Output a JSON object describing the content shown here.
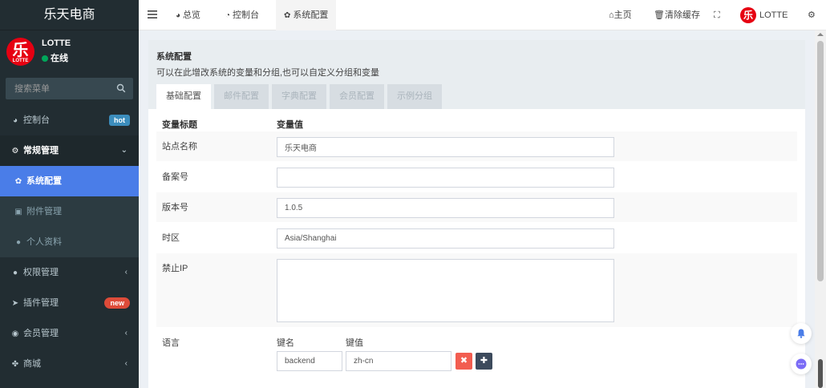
{
  "brand": {
    "title": "乐天电商",
    "avatar_char": "乐",
    "avatar_sub": "LOTTE"
  },
  "user": {
    "name": "LOTTE",
    "status": "在线"
  },
  "search": {
    "placeholder": "搜索菜单"
  },
  "sidebar": {
    "items": [
      {
        "label": "控制台",
        "icon": "dashboard-icon",
        "badge": "hot"
      },
      {
        "label": "常规管理",
        "icon": "cogs-icon",
        "expanded": true
      },
      {
        "label": "系统配置",
        "icon": "gear-icon",
        "active": true
      },
      {
        "label": "附件管理",
        "icon": "file-image-icon"
      },
      {
        "label": "个人资料",
        "icon": "user-icon"
      },
      {
        "label": "权限管理",
        "icon": "group-icon"
      },
      {
        "label": "插件管理",
        "icon": "rocket-icon",
        "badge": "new"
      },
      {
        "label": "会员管理",
        "icon": "user-circle-icon"
      },
      {
        "label": "商城",
        "icon": "shop-icon"
      }
    ]
  },
  "navbar": {
    "tabs": [
      {
        "label": "总览",
        "icon": "pie-chart-icon"
      },
      {
        "label": "控制台",
        "icon": "dashboard-icon"
      },
      {
        "label": "系统配置",
        "icon": "gear-icon",
        "active": true
      }
    ],
    "home": "主页",
    "clear_cache": "清除缓存",
    "user": "LOTTE"
  },
  "panel": {
    "title": "系统配置",
    "desc": "可以在此增改系统的变量和分组,也可以自定义分组和变量",
    "tabs": [
      "基础配置",
      "邮件配置",
      "字典配置",
      "会员配置",
      "示例分组"
    ]
  },
  "form": {
    "header": {
      "title": "变量标题",
      "value": "变量值"
    },
    "rows": [
      {
        "label": "站点名称",
        "value": "乐天电商"
      },
      {
        "label": "备案号",
        "value": ""
      },
      {
        "label": "版本号",
        "value": "1.0.5"
      },
      {
        "label": "时区",
        "value": "Asia/Shanghai"
      },
      {
        "label": "禁止IP",
        "value": ""
      },
      {
        "label": "语言",
        "key_header": "键名",
        "value_header": "键值",
        "pairs": [
          {
            "key": "backend",
            "value": "zh-cn"
          }
        ]
      }
    ]
  },
  "colors": {
    "sidebar": "#222d32",
    "active": "#4a7de8",
    "hot": "#3c8dbc",
    "new": "#dd4b39",
    "delete": "#f25d50",
    "add": "#3c4a5c"
  }
}
